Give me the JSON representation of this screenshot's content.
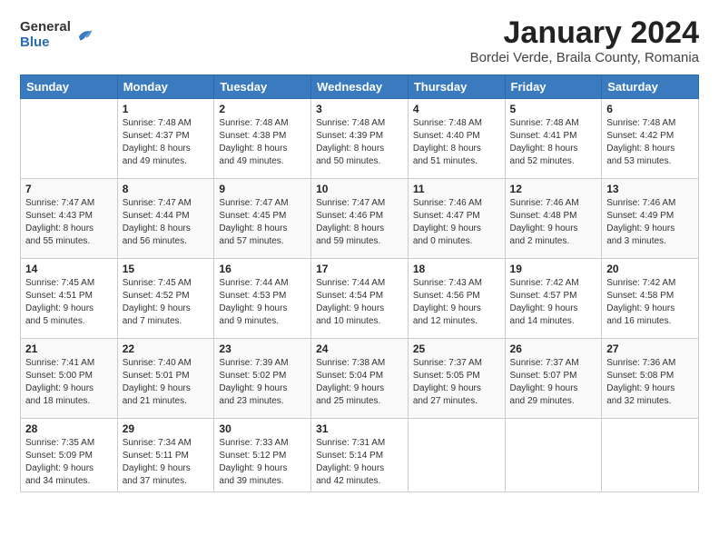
{
  "logo": {
    "general": "General",
    "blue": "Blue"
  },
  "title": {
    "month": "January 2024",
    "location": "Bordei Verde, Braila County, Romania"
  },
  "weekdays": [
    "Sunday",
    "Monday",
    "Tuesday",
    "Wednesday",
    "Thursday",
    "Friday",
    "Saturday"
  ],
  "weeks": [
    [
      {
        "day": "",
        "sunrise": "",
        "sunset": "",
        "daylight": ""
      },
      {
        "day": "1",
        "sunrise": "Sunrise: 7:48 AM",
        "sunset": "Sunset: 4:37 PM",
        "daylight": "Daylight: 8 hours and 49 minutes."
      },
      {
        "day": "2",
        "sunrise": "Sunrise: 7:48 AM",
        "sunset": "Sunset: 4:38 PM",
        "daylight": "Daylight: 8 hours and 49 minutes."
      },
      {
        "day": "3",
        "sunrise": "Sunrise: 7:48 AM",
        "sunset": "Sunset: 4:39 PM",
        "daylight": "Daylight: 8 hours and 50 minutes."
      },
      {
        "day": "4",
        "sunrise": "Sunrise: 7:48 AM",
        "sunset": "Sunset: 4:40 PM",
        "daylight": "Daylight: 8 hours and 51 minutes."
      },
      {
        "day": "5",
        "sunrise": "Sunrise: 7:48 AM",
        "sunset": "Sunset: 4:41 PM",
        "daylight": "Daylight: 8 hours and 52 minutes."
      },
      {
        "day": "6",
        "sunrise": "Sunrise: 7:48 AM",
        "sunset": "Sunset: 4:42 PM",
        "daylight": "Daylight: 8 hours and 53 minutes."
      }
    ],
    [
      {
        "day": "7",
        "sunrise": "Sunrise: 7:47 AM",
        "sunset": "Sunset: 4:43 PM",
        "daylight": "Daylight: 8 hours and 55 minutes."
      },
      {
        "day": "8",
        "sunrise": "Sunrise: 7:47 AM",
        "sunset": "Sunset: 4:44 PM",
        "daylight": "Daylight: 8 hours and 56 minutes."
      },
      {
        "day": "9",
        "sunrise": "Sunrise: 7:47 AM",
        "sunset": "Sunset: 4:45 PM",
        "daylight": "Daylight: 8 hours and 57 minutes."
      },
      {
        "day": "10",
        "sunrise": "Sunrise: 7:47 AM",
        "sunset": "Sunset: 4:46 PM",
        "daylight": "Daylight: 8 hours and 59 minutes."
      },
      {
        "day": "11",
        "sunrise": "Sunrise: 7:46 AM",
        "sunset": "Sunset: 4:47 PM",
        "daylight": "Daylight: 9 hours and 0 minutes."
      },
      {
        "day": "12",
        "sunrise": "Sunrise: 7:46 AM",
        "sunset": "Sunset: 4:48 PM",
        "daylight": "Daylight: 9 hours and 2 minutes."
      },
      {
        "day": "13",
        "sunrise": "Sunrise: 7:46 AM",
        "sunset": "Sunset: 4:49 PM",
        "daylight": "Daylight: 9 hours and 3 minutes."
      }
    ],
    [
      {
        "day": "14",
        "sunrise": "Sunrise: 7:45 AM",
        "sunset": "Sunset: 4:51 PM",
        "daylight": "Daylight: 9 hours and 5 minutes."
      },
      {
        "day": "15",
        "sunrise": "Sunrise: 7:45 AM",
        "sunset": "Sunset: 4:52 PM",
        "daylight": "Daylight: 9 hours and 7 minutes."
      },
      {
        "day": "16",
        "sunrise": "Sunrise: 7:44 AM",
        "sunset": "Sunset: 4:53 PM",
        "daylight": "Daylight: 9 hours and 9 minutes."
      },
      {
        "day": "17",
        "sunrise": "Sunrise: 7:44 AM",
        "sunset": "Sunset: 4:54 PM",
        "daylight": "Daylight: 9 hours and 10 minutes."
      },
      {
        "day": "18",
        "sunrise": "Sunrise: 7:43 AM",
        "sunset": "Sunset: 4:56 PM",
        "daylight": "Daylight: 9 hours and 12 minutes."
      },
      {
        "day": "19",
        "sunrise": "Sunrise: 7:42 AM",
        "sunset": "Sunset: 4:57 PM",
        "daylight": "Daylight: 9 hours and 14 minutes."
      },
      {
        "day": "20",
        "sunrise": "Sunrise: 7:42 AM",
        "sunset": "Sunset: 4:58 PM",
        "daylight": "Daylight: 9 hours and 16 minutes."
      }
    ],
    [
      {
        "day": "21",
        "sunrise": "Sunrise: 7:41 AM",
        "sunset": "Sunset: 5:00 PM",
        "daylight": "Daylight: 9 hours and 18 minutes."
      },
      {
        "day": "22",
        "sunrise": "Sunrise: 7:40 AM",
        "sunset": "Sunset: 5:01 PM",
        "daylight": "Daylight: 9 hours and 21 minutes."
      },
      {
        "day": "23",
        "sunrise": "Sunrise: 7:39 AM",
        "sunset": "Sunset: 5:02 PM",
        "daylight": "Daylight: 9 hours and 23 minutes."
      },
      {
        "day": "24",
        "sunrise": "Sunrise: 7:38 AM",
        "sunset": "Sunset: 5:04 PM",
        "daylight": "Daylight: 9 hours and 25 minutes."
      },
      {
        "day": "25",
        "sunrise": "Sunrise: 7:37 AM",
        "sunset": "Sunset: 5:05 PM",
        "daylight": "Daylight: 9 hours and 27 minutes."
      },
      {
        "day": "26",
        "sunrise": "Sunrise: 7:37 AM",
        "sunset": "Sunset: 5:07 PM",
        "daylight": "Daylight: 9 hours and 29 minutes."
      },
      {
        "day": "27",
        "sunrise": "Sunrise: 7:36 AM",
        "sunset": "Sunset: 5:08 PM",
        "daylight": "Daylight: 9 hours and 32 minutes."
      }
    ],
    [
      {
        "day": "28",
        "sunrise": "Sunrise: 7:35 AM",
        "sunset": "Sunset: 5:09 PM",
        "daylight": "Daylight: 9 hours and 34 minutes."
      },
      {
        "day": "29",
        "sunrise": "Sunrise: 7:34 AM",
        "sunset": "Sunset: 5:11 PM",
        "daylight": "Daylight: 9 hours and 37 minutes."
      },
      {
        "day": "30",
        "sunrise": "Sunrise: 7:33 AM",
        "sunset": "Sunset: 5:12 PM",
        "daylight": "Daylight: 9 hours and 39 minutes."
      },
      {
        "day": "31",
        "sunrise": "Sunrise: 7:31 AM",
        "sunset": "Sunset: 5:14 PM",
        "daylight": "Daylight: 9 hours and 42 minutes."
      },
      {
        "day": "",
        "sunrise": "",
        "sunset": "",
        "daylight": ""
      },
      {
        "day": "",
        "sunrise": "",
        "sunset": "",
        "daylight": ""
      },
      {
        "day": "",
        "sunrise": "",
        "sunset": "",
        "daylight": ""
      }
    ]
  ]
}
